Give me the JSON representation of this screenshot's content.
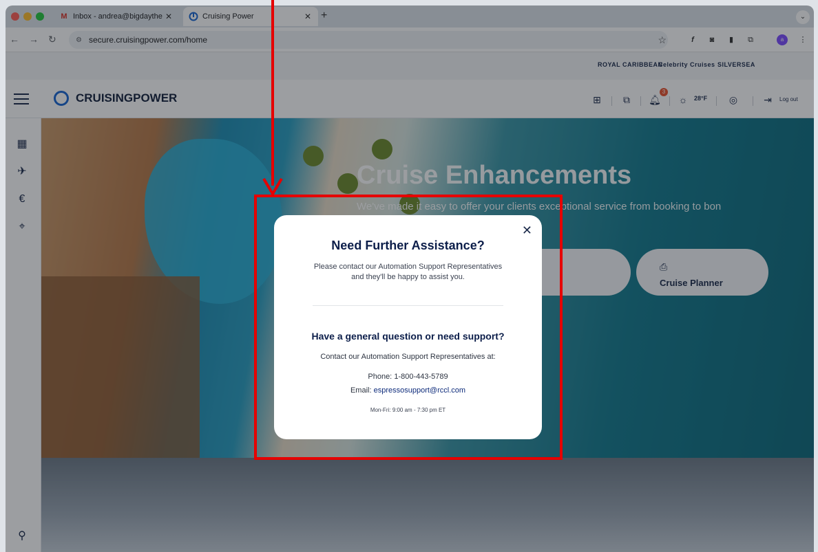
{
  "browser": {
    "tabs": [
      {
        "icon": "gmail-icon",
        "label": "Inbox - andrea@bigdaytheag",
        "active": false
      },
      {
        "icon": "cruisingpower-icon",
        "label": "Cruising Power",
        "active": true
      }
    ],
    "url": "secure.cruisingpower.com/home"
  },
  "site": {
    "brands": [
      "ROYAL CARIBBEAN",
      "Celebrity Cruises",
      "SILVERSEA"
    ],
    "logo_text": "CRUISINGPOWER",
    "notification_count": "3",
    "weather": "28°F",
    "logout_label": "Log out",
    "hero": {
      "title": "Cruise Enhancements",
      "subtitle": "We've made it easy to offer your clients exceptional service from booking to bon",
      "button_label": "Cruise Planner"
    }
  },
  "modal": {
    "title": "Need Further Assistance?",
    "intro": "Please contact our Automation Support Representatives and they'll be happy to assist you.",
    "question": "Have a general question or need support?",
    "contact_line": "Contact our Automation Support Representatives at:",
    "phone_label": "Phone:",
    "phone": "1-800-443-5789",
    "email_label": "Email:",
    "email": "espressosupport@rccl.com",
    "hours": "Mon-Fri: 9:00 am - 7:30 pm ET"
  },
  "colors": {
    "annotation": "#e60000",
    "brand_navy": "#0c1e4a"
  }
}
